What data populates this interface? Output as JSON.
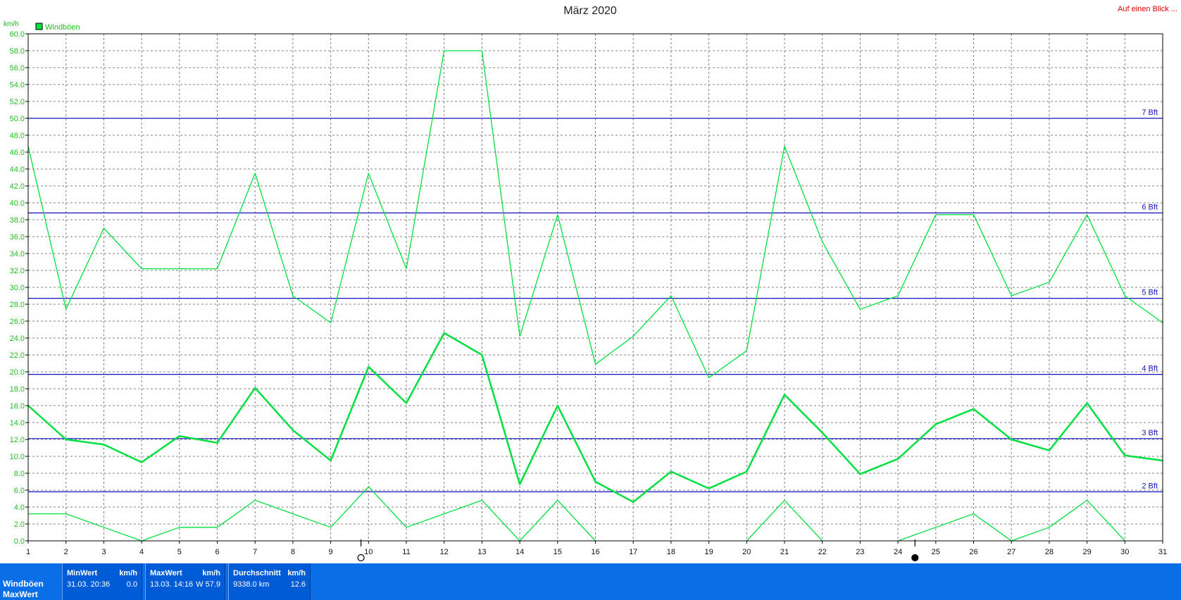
{
  "title": "März 2020",
  "unit_label": "km/h",
  "link_label": "Auf einen Blick ...",
  "legend": {
    "label": "Windböen",
    "color": "#00e040"
  },
  "colors": {
    "grid": "#808080",
    "bft": "#1010c0",
    "line": "#00e040",
    "moon": "#000000"
  },
  "chart_data": {
    "type": "line",
    "title": "März 2020",
    "xlabel": "",
    "ylabel": "km/h",
    "xlim": [
      1,
      31
    ],
    "ylim": [
      0,
      60
    ],
    "y_tick_step": 2,
    "grid": true,
    "legend_position": "top-left",
    "x": [
      1,
      2,
      3,
      4,
      5,
      6,
      7,
      8,
      9,
      10,
      11,
      12,
      13,
      14,
      15,
      16,
      17,
      18,
      19,
      20,
      21,
      22,
      23,
      24,
      25,
      26,
      27,
      28,
      29,
      30,
      31
    ],
    "x_ticks": [
      "1",
      "2",
      "3",
      "4",
      "5",
      "6",
      "7",
      "8",
      "9",
      "10",
      "11",
      "12",
      "13",
      "14",
      "15",
      "16",
      "17",
      "18",
      "19",
      "20",
      "21",
      "22",
      "23",
      "24",
      "25",
      "26",
      "27",
      "28",
      "29",
      "30",
      "31"
    ],
    "series": [
      {
        "name": "Windböen",
        "role": "max",
        "values": [
          46.7,
          27.4,
          37.0,
          32.2,
          32.2,
          32.2,
          43.5,
          29.0,
          25.8,
          43.5,
          32.2,
          58.0,
          58.0,
          24.2,
          38.6,
          20.9,
          24.2,
          29.0,
          19.3,
          22.5,
          46.7,
          35.4,
          27.4,
          29.0,
          38.6,
          38.6,
          29.0,
          30.6,
          38.6,
          29.0,
          25.8
        ]
      },
      {
        "name": "Windböen",
        "role": "avg",
        "values": [
          16.0,
          12.0,
          11.4,
          9.3,
          12.4,
          11.6,
          18.1,
          13.1,
          9.5,
          20.6,
          16.3,
          24.6,
          22.0,
          6.7,
          16.0,
          7.0,
          4.6,
          8.2,
          6.2,
          8.2,
          17.3,
          12.8,
          7.9,
          9.7,
          13.8,
          15.6,
          12.0,
          10.7,
          16.3,
          10.1,
          9.5
        ]
      },
      {
        "name": "Windböen",
        "role": "min",
        "values": [
          3.2,
          3.2,
          1.6,
          0.0,
          1.6,
          1.6,
          4.8,
          3.2,
          1.6,
          6.4,
          1.6,
          3.2,
          4.8,
          0.0,
          4.8,
          0.0,
          null,
          null,
          null,
          0.0,
          4.8,
          0.0,
          null,
          0.0,
          1.6,
          3.2,
          0.0,
          1.6,
          4.8,
          0.0,
          null
        ]
      }
    ],
    "reference_lines": [
      {
        "label": "2 Bft",
        "value": 5.8
      },
      {
        "label": "3 Bft",
        "value": 12.1
      },
      {
        "label": "4 Bft",
        "value": 19.7
      },
      {
        "label": "5 Bft",
        "value": 28.7
      },
      {
        "label": "6 Bft",
        "value": 38.8
      },
      {
        "label": "7 Bft",
        "value": 50.0
      }
    ],
    "moon_phases": [
      {
        "x": 9.8,
        "phase": "full-moon"
      },
      {
        "x": 24.45,
        "phase": "new-moon"
      }
    ]
  },
  "stats": {
    "row_labels": [
      "Windböen",
      "MaxWert"
    ],
    "min": {
      "header": "MinWert",
      "unit": "km/h",
      "datetime": "31.03.  20:36",
      "value": "0.0"
    },
    "max": {
      "header": "MaxWert",
      "unit": "km/h",
      "datetime": "13.03.  14:16",
      "value": "W 57.9"
    },
    "avg": {
      "header": "Durchschnitt",
      "unit": "km/h",
      "datetime": "9338.0 km",
      "value": "12.6"
    }
  }
}
